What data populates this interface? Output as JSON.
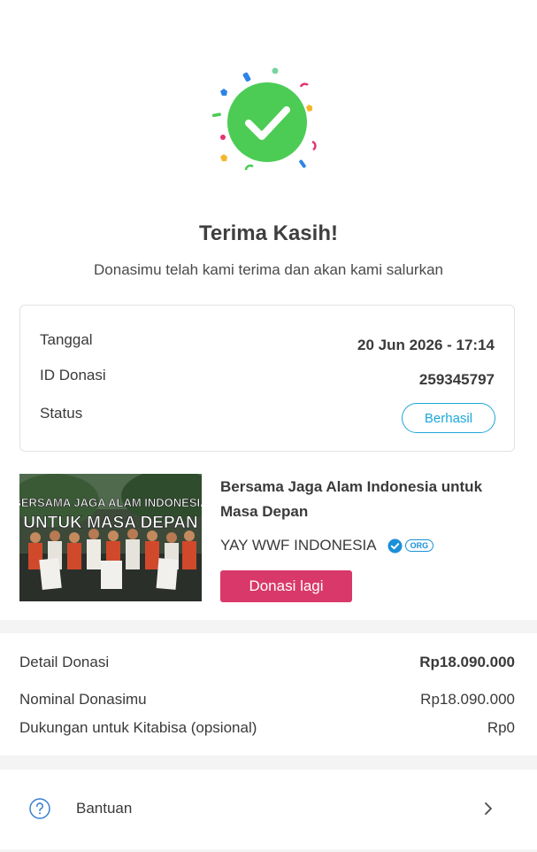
{
  "success": {
    "title": "Terima Kasih!",
    "subtitle": "Donasimu telah kami terima dan akan kami salurkan",
    "icon": "check-circle-icon",
    "color": "#4ccc55"
  },
  "info": {
    "date_label": "Tanggal",
    "date_value": "20 Jun 2026 - 17:14",
    "id_label": "ID Donasi",
    "id_value": "259345797",
    "status_label": "Status",
    "status_value": "Berhasil"
  },
  "campaign": {
    "title": "Bersama Jaga Alam Indonesia untuk Masa Depan",
    "image_caption_line1": "BERSAMA JAGA ALAM INDONESIA",
    "image_caption_line2": "UNTUK MASA DEPAN",
    "organizer": "YAY WWF INDONESIA",
    "org_tag": "ORG",
    "donate_again_label": "Donasi lagi",
    "accent": "#d9386a"
  },
  "detail": {
    "header_label": "Detail Donasi",
    "header_value": "Rp18.090.000",
    "nominal_label": "Nominal Donasimu",
    "nominal_value": "Rp18.090.000",
    "support_label": "Dukungan untuk Kitabisa (opsional)",
    "support_value": "Rp0"
  },
  "help": {
    "label": "Bantuan",
    "icon": "question-circle-icon"
  }
}
